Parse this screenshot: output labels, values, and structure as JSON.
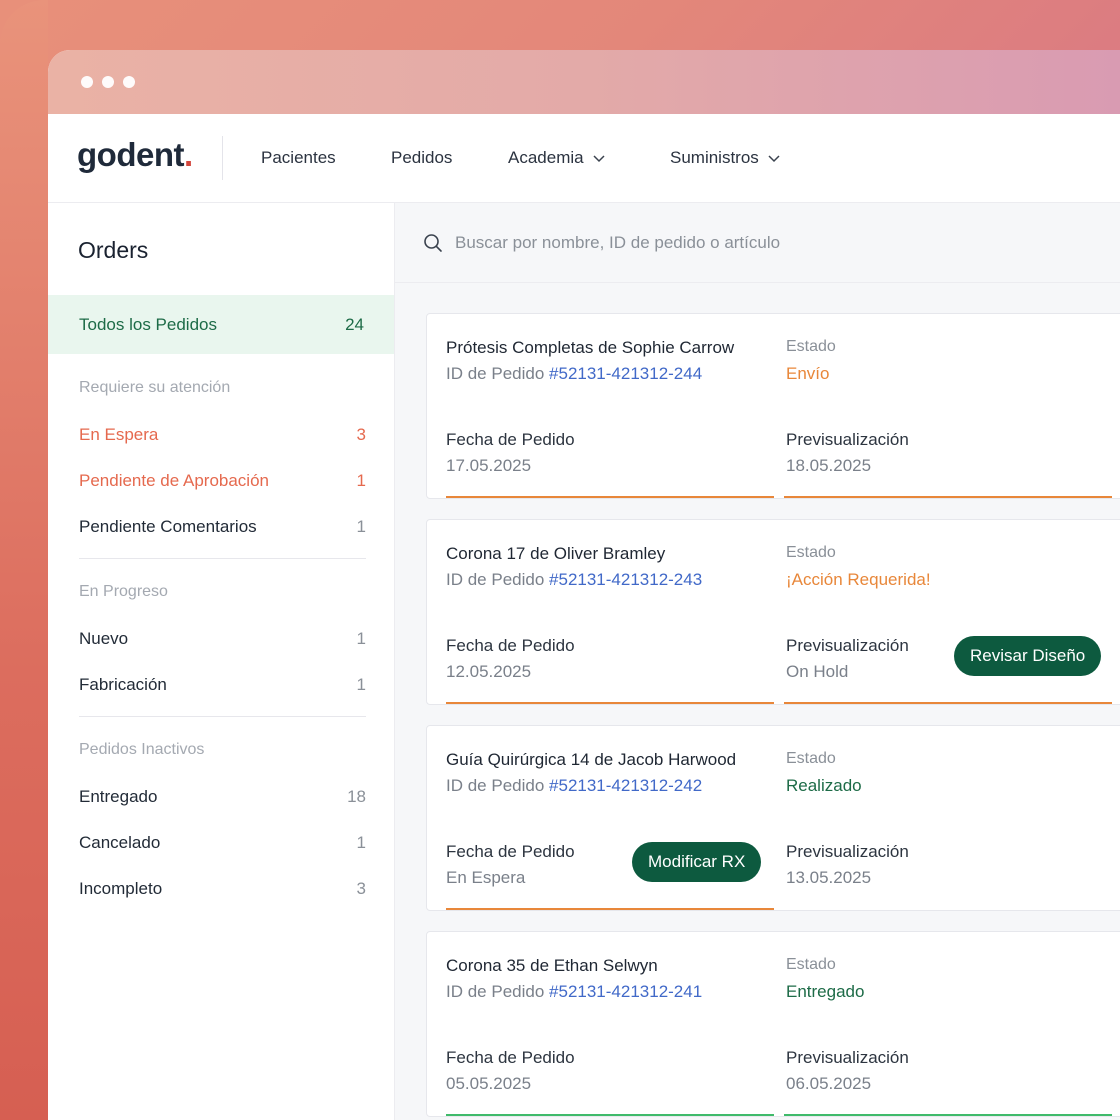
{
  "app": {
    "logo": "godent",
    "logo_dot": "."
  },
  "nav": {
    "items": [
      {
        "label": "Pacientes",
        "dropdown": false
      },
      {
        "label": "Pedidos",
        "dropdown": false
      },
      {
        "label": "Academia",
        "dropdown": true
      },
      {
        "label": "Suministros",
        "dropdown": true
      }
    ]
  },
  "sidebar": {
    "title": "Orders",
    "all_orders": {
      "label": "Todos los Pedidos",
      "count": "24"
    },
    "sections": [
      {
        "title": "Requiere su atención",
        "items": [
          {
            "label": "En Espera",
            "count": "3",
            "alert": true
          },
          {
            "label": "Pendiente de Aprobación",
            "count": "1",
            "alert": true
          },
          {
            "label": "Pendiente Comentarios",
            "count": "1",
            "alert": false
          }
        ]
      },
      {
        "title": "En Progreso",
        "items": [
          {
            "label": "Nuevo",
            "count": "1",
            "alert": false
          },
          {
            "label": "Fabricación",
            "count": "1",
            "alert": false
          }
        ]
      },
      {
        "title": "Pedidos Inactivos",
        "items": [
          {
            "label": "Entregado",
            "count": "18",
            "alert": false
          },
          {
            "label": "Cancelado",
            "count": "1",
            "alert": false
          },
          {
            "label": "Incompleto",
            "count": "3",
            "alert": false
          }
        ]
      }
    ]
  },
  "search": {
    "placeholder": "Buscar por nombre, ID de pedido o artículo"
  },
  "labels": {
    "order_id": "ID de Pedido",
    "status": "Estado",
    "order_date": "Fecha de Pedido",
    "preview": "Previsualización"
  },
  "colors": {
    "accent_green": "#0d5a3f",
    "status_orange": "#e8873a",
    "status_green": "#1d6b47",
    "alert_red": "#e5694e",
    "link_blue": "#4169c8"
  },
  "orders": [
    {
      "name": "Prótesis Completas de Sophie Carrow",
      "id": "#52131-421312-244",
      "status": "Envío",
      "status_color": "#e8873a",
      "order_date": "17.05.2025",
      "preview": "18.05.2025",
      "line_color": "#e8873a"
    },
    {
      "name": "Corona 17 de Oliver Bramley",
      "id": "#52131-421312-243",
      "status": "¡Acción Requerida!",
      "status_color": "#e8873a",
      "order_date": "12.05.2025",
      "preview": "On Hold",
      "button": "Revisar Diseño",
      "line_color": "#e8873a"
    },
    {
      "name": "Guía Quirúrgica 14 de Jacob Harwood",
      "id": "#52131-421312-242",
      "status": "Realizado",
      "status_color": "#1d6b47",
      "order_date": "En Espera",
      "preview": "13.05.2025",
      "button": "Modificar RX",
      "line_color": "#e8873a"
    },
    {
      "name": "Corona 35 de Ethan Selwyn",
      "id": "#52131-421312-241",
      "status": "Entregado",
      "status_color": "#1d6b47",
      "order_date": "05.05.2025",
      "preview": "06.05.2025",
      "line_color": "#3fba6a"
    }
  ]
}
